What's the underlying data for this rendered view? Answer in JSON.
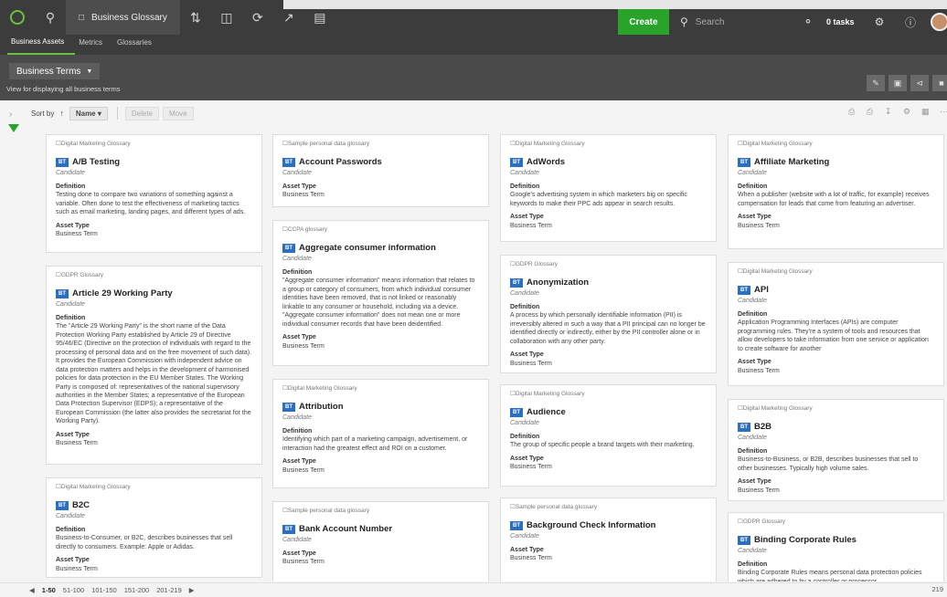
{
  "topbar": {
    "active_tab": "Business Glossary",
    "create_label": "Create",
    "search_placeholder": "Search",
    "tasks_label": "0 tasks"
  },
  "subnav": {
    "items": [
      "Business Assets",
      "Metrics",
      "Glossaries"
    ]
  },
  "header": {
    "view_name": "Business Terms",
    "view_desc": "View for displaying all business terms"
  },
  "toolbar": {
    "sort_by": "Sort by",
    "sort_field": "Name",
    "delete_label": "Delete",
    "move_label": "Move"
  },
  "labels": {
    "badge": "BT",
    "definition": "Definition",
    "asset_type": "Asset Type"
  },
  "cards": [
    {
      "glossary": "Digital Marketing Glossary",
      "title": "A/B Testing",
      "status": "Candidate",
      "definition": "Testing done to compare two variations of something against a variable. Often done to test the effectiveness of marketing tactics such as email marketing, landing pages, and different types of ads.",
      "asset_type": "Business Term"
    },
    {
      "glossary": "GDPR Glossary",
      "title": "Article 29 Working Party",
      "status": "Candidate",
      "definition": "The \"Article 29 Working Party\" is the short name of the Data Protection Working Party established by Article 29 of Directive 95/46/EC (Directive on the protection of individuals with regard to the processing of personal data and on the free movement of such data). It provides the European Commission with independent advice on data protection matters and helps in the development of harmonised policies for data protection in the EU Member States. The Working Party is composed of: representatives of the national supervisory authorities in the Member States; a representative of the European Data Protection Supervisor (EDPS); a representative of the European Commission (the latter also provides the secretariat for the Working Party).",
      "asset_type": "Business Term"
    },
    {
      "glossary": "Digital Marketing Glossary",
      "title": "B2C",
      "status": "Candidate",
      "definition": "Business-to-Consumer, or B2C, describes businesses that sell directly to consumers. Example: Apple or Adidas.",
      "asset_type": "Business Term"
    },
    {
      "glossary": "Sample personal data glossary",
      "title": "Account Passwords",
      "status": "Candidate",
      "definition": "",
      "asset_type": "Business Term"
    },
    {
      "glossary": "CCPA glossary",
      "title": "Aggregate consumer information",
      "status": "Candidate",
      "definition": "\"Aggregate consumer information\" means information that relates to a group or category of consumers, from which individual consumer identities have been removed, that is not linked or reasonably linkable to any consumer or household, including via a device. \"Aggregate consumer information\" does not mean one or more individual consumer records that have been deidentified.",
      "asset_type": "Business Term"
    },
    {
      "glossary": "Digital Marketing Glossary",
      "title": "Attribution",
      "status": "Candidate",
      "definition": "Identifying which part of a marketing campaign, advertisement, or interaction had the greatest effect and ROI on a customer.",
      "asset_type": "Business Term"
    },
    {
      "glossary": "Sample personal data glossary",
      "title": "Bank Account Number",
      "status": "Candidate",
      "definition": "",
      "asset_type": "Business Term"
    },
    {
      "glossary": "Digital Marketing Glossary",
      "title": "AdWords",
      "status": "Candidate",
      "definition": "Google's advertising system in which marketers big on specific keywords to make their PPC ads appear in search results.",
      "asset_type": "Business Term"
    },
    {
      "glossary": "GDPR Glossary",
      "title": "Anonymization",
      "status": "Candidate",
      "definition": "A process by which personally identifiable information (PII) is irreversibly altered in such a way that a PII principal can no longer be identified directly or indirectly, either by the PII controller alone or in collaboration with any other party.",
      "asset_type": "Business Term"
    },
    {
      "glossary": "Digital Marketing Glossary",
      "title": "Audience",
      "status": "Candidate",
      "definition": "The group of specific people a brand targets with their marketing.",
      "asset_type": "Business Term"
    },
    {
      "glossary": "Sample personal data glossary",
      "title": "Background Check Information",
      "status": "Candidate",
      "definition": "",
      "asset_type": "Business Term"
    },
    {
      "glossary": "Digital Marketing Glossary",
      "title": "Affiliate Marketing",
      "status": "Candidate",
      "definition": "When a publisher (website with a lot of traffic, for example) receives compensation for leads that come from featuring an advertiser.",
      "asset_type": "Business Term"
    },
    {
      "glossary": "Digital Marketing Glossary",
      "title": "API",
      "status": "Candidate",
      "definition": "Application Programming Interfaces (APIs) are computer programming rules. They're a system of tools and resources that allow developers to take information from one service or application to create software for another",
      "asset_type": "Business Term"
    },
    {
      "glossary": "Digital Marketing Glossary",
      "title": "B2B",
      "status": "Candidate",
      "definition": "Business-to-Business, or B2B, describes businesses that sell to other businesses. Typically high volume sales.",
      "asset_type": "Business Term"
    },
    {
      "glossary": "GDPR Glossary",
      "title": "Binding Corporate Rules",
      "status": "Candidate",
      "definition": "Binding Corporate Rules means personal data protection policies which are adhered to by a controller or processor",
      "asset_type": ""
    }
  ],
  "pagination": {
    "pages": [
      "1-50",
      "51-100",
      "101-150",
      "151-200",
      "201-219"
    ],
    "total": "219"
  }
}
